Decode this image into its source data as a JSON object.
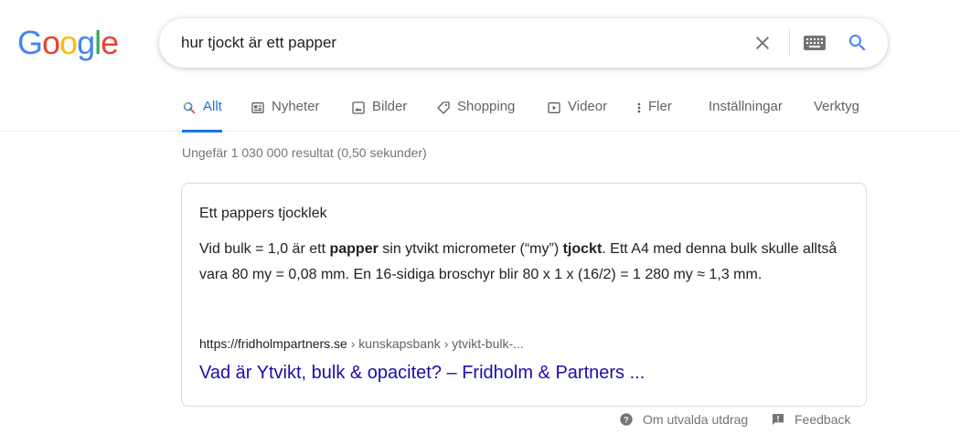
{
  "logo": {
    "letters": [
      "G",
      "o",
      "o",
      "g",
      "l",
      "e"
    ],
    "colors": [
      "#4285F4",
      "#EA4335",
      "#FBBC05",
      "#4285F4",
      "#34A853",
      "#EA4335"
    ]
  },
  "search": {
    "query": "hur tjockt är ett papper",
    "icons": [
      "clear-icon",
      "keyboard-icon",
      "search-icon"
    ]
  },
  "tabs": [
    {
      "label": "Allt",
      "icon": "search-icon",
      "active": true
    },
    {
      "label": "Nyheter",
      "icon": "news-icon"
    },
    {
      "label": "Bilder",
      "icon": "image-icon"
    },
    {
      "label": "Shopping",
      "icon": "tag-icon"
    },
    {
      "label": "Videor",
      "icon": "video-icon"
    },
    {
      "label": "Fler",
      "icon": "more-vert-icon"
    },
    {
      "label": "Inställningar"
    },
    {
      "label": "Verktyg"
    }
  ],
  "stats": "Ungefär 1 030 000 resultat (0,50 sekunder)",
  "featured": {
    "heading": "Ett pappers tjocklek",
    "snippet_parts": [
      {
        "text": "Vid bulk = 1,0 är ett ",
        "bold": false
      },
      {
        "text": "papper",
        "bold": true
      },
      {
        "text": " sin ytvikt micrometer (“my”) ",
        "bold": false
      },
      {
        "text": "tjockt",
        "bold": true
      },
      {
        "text": ". Ett A4 med denna bulk skulle alltså vara 80 my = 0,08 mm. En 16-sidiga broschyr blir 80 x 1 x (16/2) = 1 280 my ≈ 1,3 mm.",
        "bold": false
      }
    ],
    "cite_domain": "https://fridholmpartners.se",
    "cite_path": " › kunskapsbank › ytvikt-bulk-...",
    "link_title": "Vad är Ytvikt, bulk & opacitet? – Fridholm & Partners ..."
  },
  "footer": {
    "about_label": "Om utvalda utdrag",
    "feedback_label": "Feedback"
  },
  "colors": {
    "accent": "#1a73e8",
    "link": "#1a0dab",
    "muted": "#70757a"
  }
}
